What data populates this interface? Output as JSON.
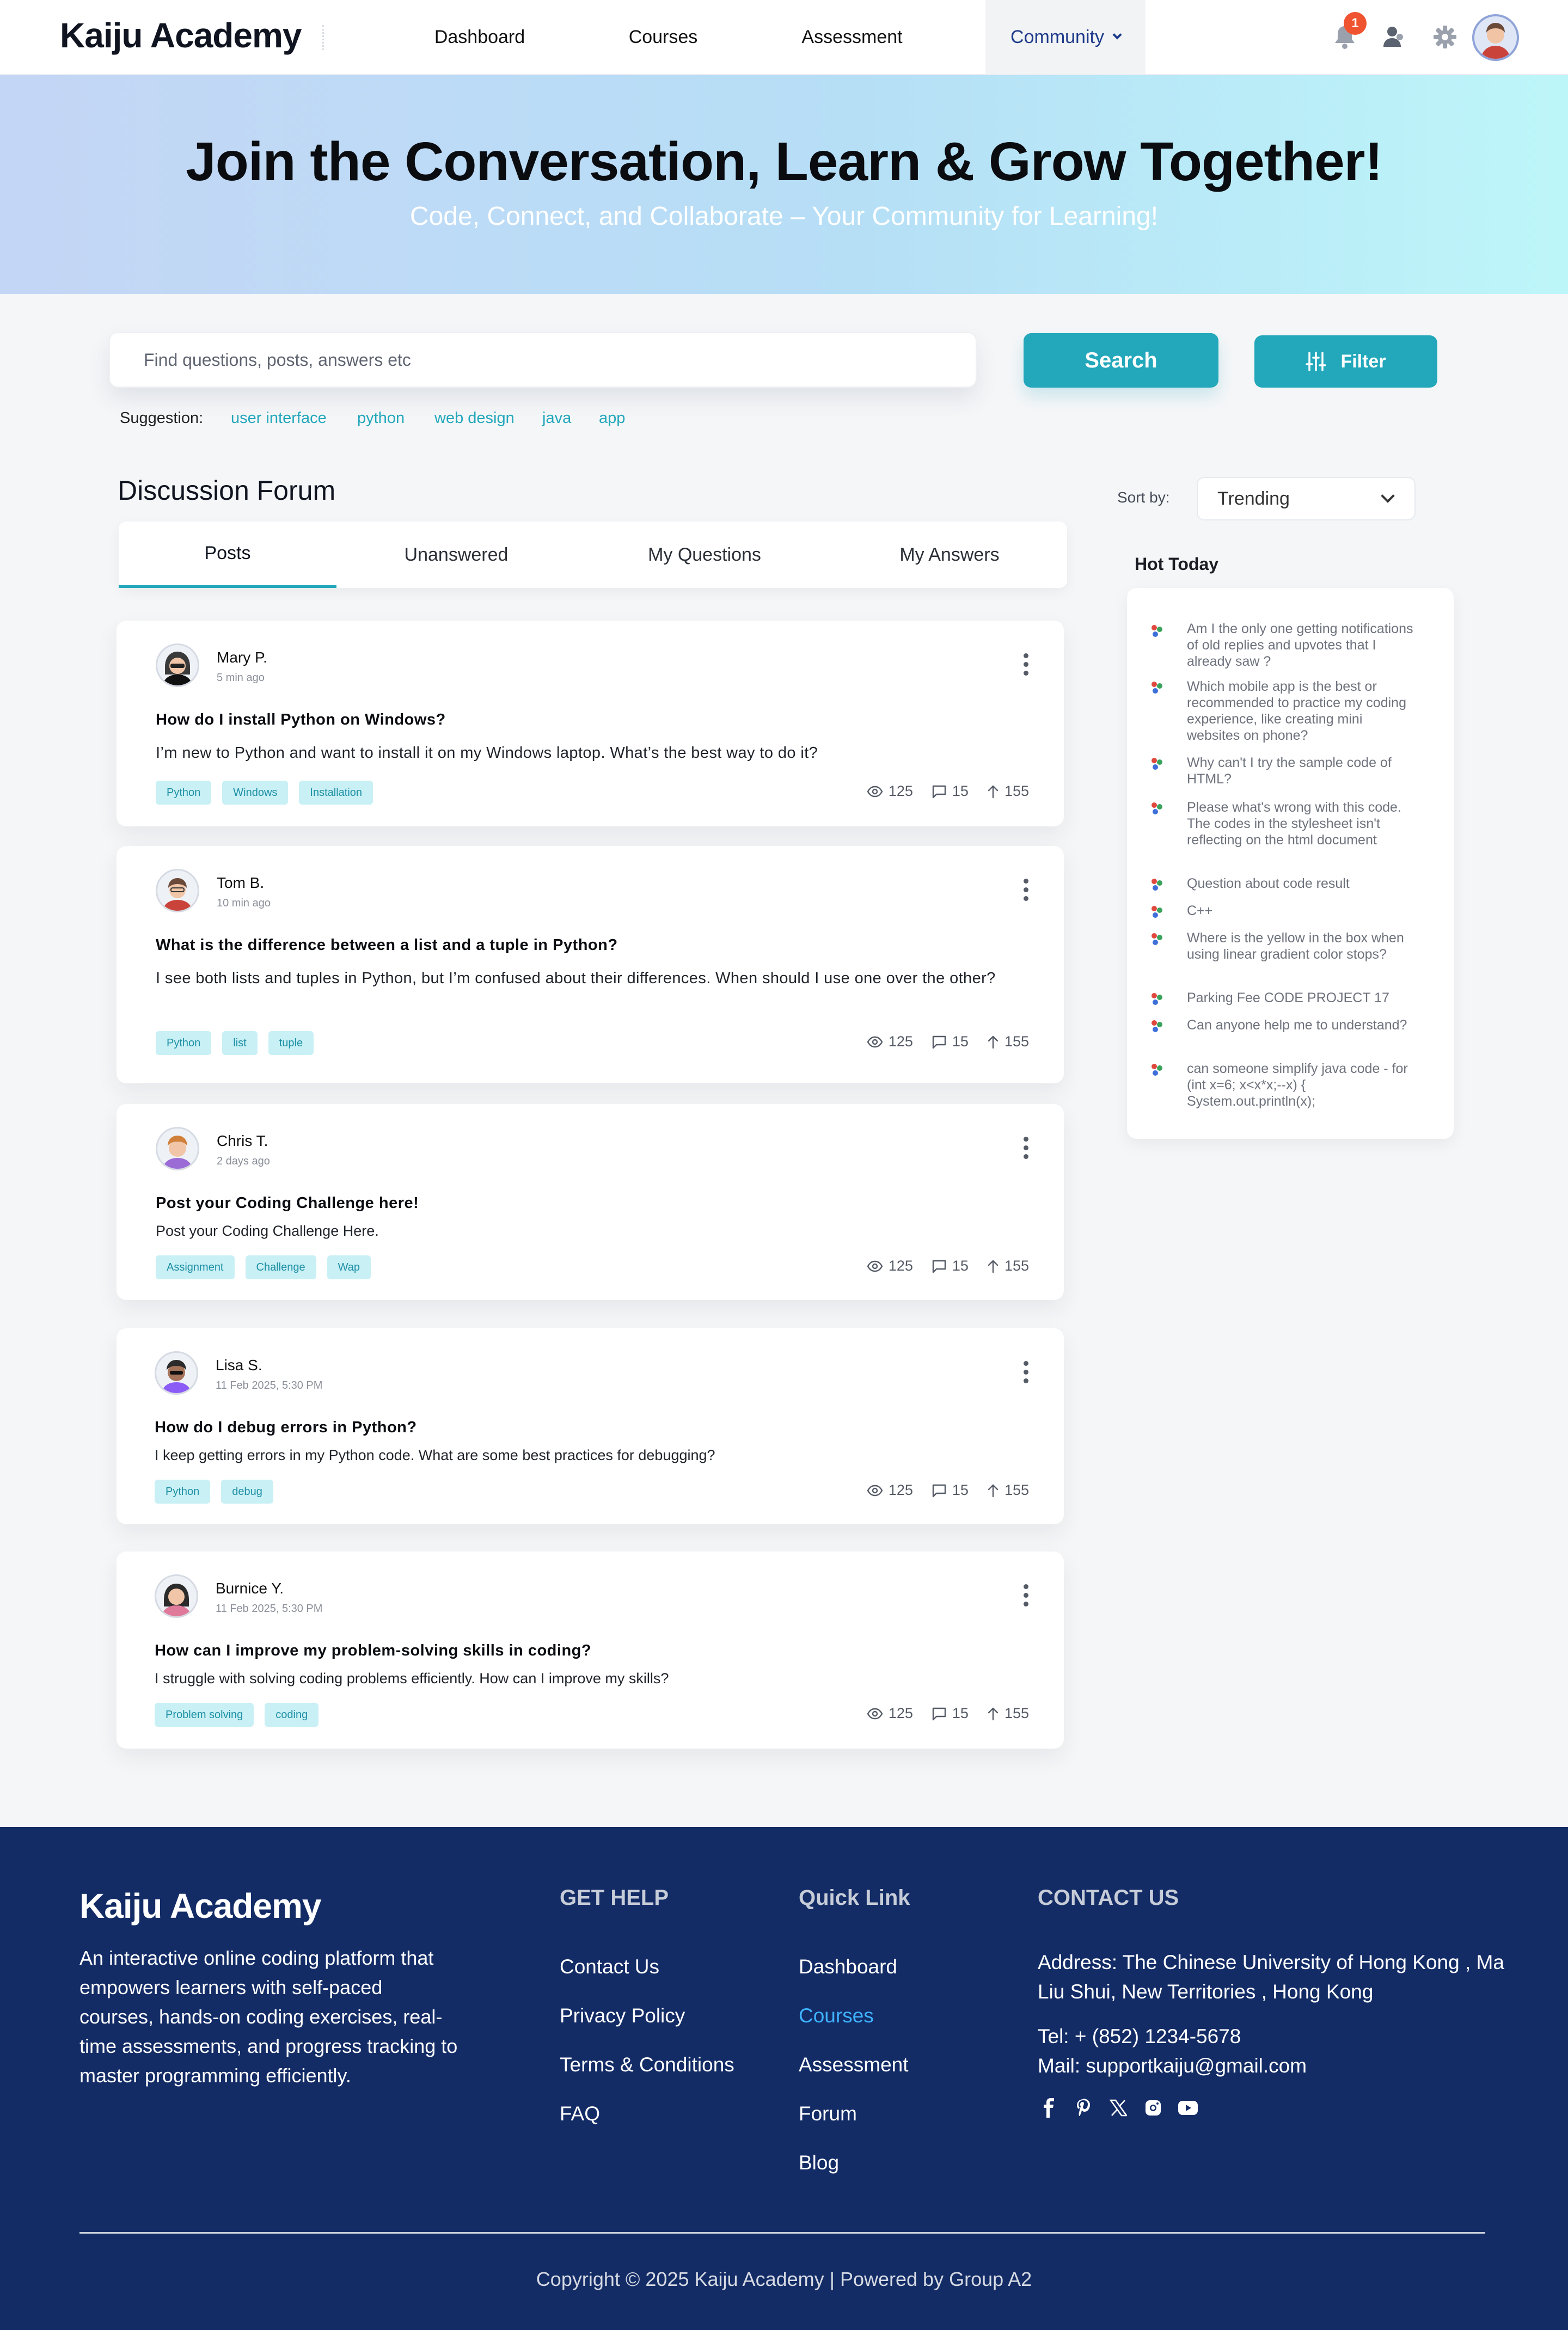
{
  "header": {
    "logo": "Kaiju Academy",
    "nav": [
      {
        "label": "Dashboard"
      },
      {
        "label": "Courses"
      },
      {
        "label": "Assessment"
      },
      {
        "label": "Community"
      }
    ],
    "notification_count": "1",
    "icons": [
      "bell-icon",
      "users-icon",
      "gear-icon",
      "avatar"
    ]
  },
  "hero": {
    "title": "Join the Conversation, Learn & Grow Together!",
    "subtitle": "Code, Connect, and Collaborate – Your Community for Learning!"
  },
  "search": {
    "placeholder": "Find questions, posts, answers etc",
    "button_label": "Search",
    "filter_label": "Filter",
    "suggestion_label": "Suggestion:",
    "suggestions": [
      "user interface",
      "python",
      "web design",
      "java",
      "app"
    ]
  },
  "forum": {
    "title": "Discussion Forum",
    "tabs": [
      "Posts",
      "Unanswered",
      "My Questions",
      "My Answers"
    ],
    "posts": [
      {
        "author": "Mary P.",
        "time": "5 min ago",
        "title": "How do I install Python on Windows?",
        "body": "I’m new to Python and want to install it on my Windows laptop. What’s the best way to do it?",
        "tags": [
          "Python",
          "Windows",
          "Installation"
        ],
        "views": "125",
        "comments": "15",
        "votes": "155"
      },
      {
        "author": "Tom B.",
        "time": "10 min ago",
        "title": "What is the difference between a list and a tuple in Python?",
        "body": "I see both lists and tuples in Python, but I’m confused about their differences. When should I use one over the other?",
        "tags": [
          "Python",
          "list",
          "tuple"
        ],
        "views": "125",
        "comments": "15",
        "votes": "155"
      },
      {
        "author": "Chris T.",
        "time": "2 days ago",
        "title": "Post your Coding Challenge here!",
        "body": "Post your Coding Challenge Here.",
        "tags": [
          "Assignment",
          "Challenge",
          "Wap"
        ],
        "views": "125",
        "comments": "15",
        "votes": "155"
      },
      {
        "author": "Lisa S.",
        "time": "11 Feb 2025, 5:30 PM",
        "title": "How do I debug errors in Python?",
        "body": "I keep getting errors in my Python code. What are some best practices for debugging?",
        "tags": [
          "Python",
          "debug"
        ],
        "views": "125",
        "comments": "15",
        "votes": "155"
      },
      {
        "author": "Burnice Y.",
        "time": "11 Feb 2025, 5:30 PM",
        "title": "How can I improve my problem-solving skills in coding?",
        "body": "I struggle with solving coding problems efficiently. How can I improve my skills?",
        "tags": [
          "Problem solving",
          "coding"
        ],
        "views": "125",
        "comments": "15",
        "votes": "155"
      }
    ]
  },
  "sidebar": {
    "sort_label": "Sort by:",
    "sort_value": "Trending",
    "hot_title": "Hot Today",
    "hot_items": [
      "Am I the only one getting notifications of old replies and upvotes that I already saw ?",
      "Which mobile app is the best or recommended to practice my coding experience, like creating mini websites on phone?",
      "Why can't I try the sample code of HTML?",
      "Please what's wrong with this code. The codes in the stylesheet isn't reflecting on the html document",
      "Question about code result",
      "C++",
      "Where is the yellow in the box when using linear gradient color stops?",
      "Parking Fee CODE PROJECT 17",
      "Can anyone help me to understand?",
      "can someone simplify java code - for (int x=6; x<x*x;--x) { System.out.println(x);"
    ]
  },
  "footer": {
    "logo": "Kaiju Academy",
    "description": "An interactive online coding platform that empowers learners with self-paced courses, hands-on coding exercises, real-time assessments, and progress tracking to master programming efficiently.",
    "get_help_title": "GET HELP",
    "get_help_links": [
      "Contact Us",
      "Privacy Policy",
      "Terms & Conditions",
      "FAQ"
    ],
    "quick_link_title": "Quick Link",
    "quick_links": [
      "Dashboard",
      "Courses",
      "Assessment",
      "Forum",
      "Blog"
    ],
    "contact_title": "CONTACT US",
    "address": "Address: The Chinese University of Hong Kong , Ma Liu Shui, New Territories , Hong Kong",
    "tel": "Tel: + (852) 1234-5678",
    "mail": "Mail: supportkaiju@gmail.com",
    "socials": [
      "facebook-icon",
      "pinterest-icon",
      "x-icon",
      "instagram-icon",
      "youtube-icon"
    ],
    "copyright": "Copyright © 2025 Kaiju Academy | Powered by Group A2"
  },
  "colors": {
    "accent": "#22a7bb",
    "footer_bg": "#132c66",
    "nav_active": "#1d3a8a",
    "badge": "#f0532f"
  }
}
